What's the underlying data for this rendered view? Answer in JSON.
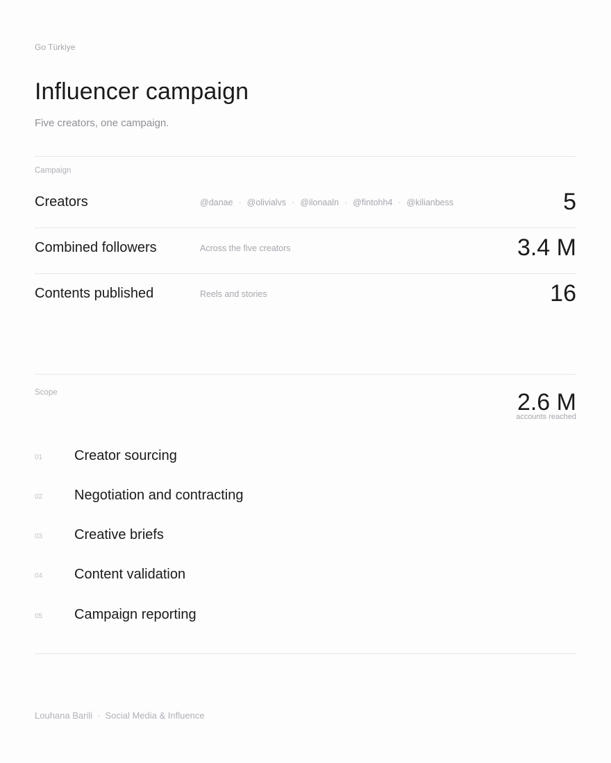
{
  "header": {
    "kicker": "Go Türkiye",
    "title": "Influencer campaign",
    "subtitle": "Five creators, one campaign."
  },
  "campaign": {
    "section_label": "Campaign",
    "rows": [
      {
        "label": "Creators",
        "handles": [
          "@danae",
          "@olivialvs",
          "@ilonaaln",
          "@fintohh4",
          "@kilianbess"
        ],
        "separator": "·",
        "value": "5"
      },
      {
        "label": "Combined followers",
        "description": "Across the five creators",
        "value": "3.4 M"
      },
      {
        "label": "Contents published",
        "description": "Reels and stories",
        "value": "16"
      }
    ]
  },
  "scope": {
    "section_label": "Scope",
    "reach_value": "2.6 M",
    "reach_caption": "accounts reached",
    "items": [
      {
        "number": "01",
        "label": "Creator sourcing"
      },
      {
        "number": "02",
        "label": "Negotiation and contracting"
      },
      {
        "number": "03",
        "label": "Creative briefs"
      },
      {
        "number": "04",
        "label": "Content validation"
      },
      {
        "number": "05",
        "label": "Campaign reporting"
      }
    ]
  },
  "footer": {
    "author": "Louhana Barili",
    "separator": "·",
    "role": "Social Media & Influence"
  }
}
